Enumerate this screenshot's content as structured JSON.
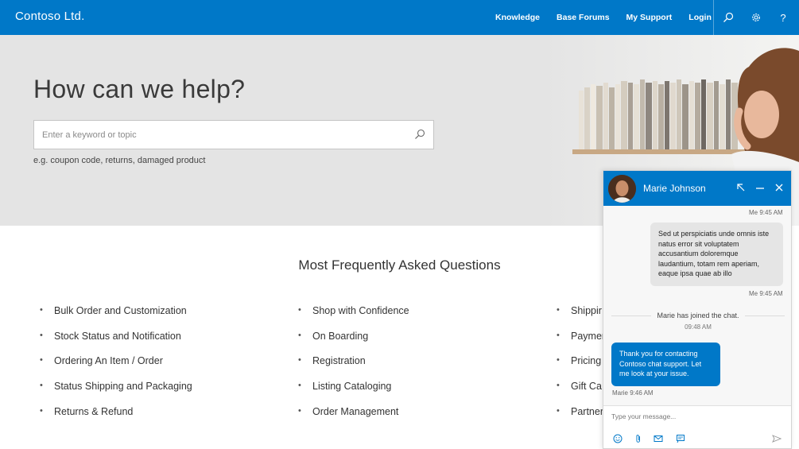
{
  "header": {
    "brand": "Contoso Ltd.",
    "nav": [
      "Knowledge",
      "Base Forums",
      "My Support",
      "Login"
    ],
    "icons": [
      "search-icon",
      "gear-icon",
      "help-icon"
    ],
    "color": "#0078c8"
  },
  "hero": {
    "title": "How can we help?",
    "search_placeholder": "Enter a keyword or topic",
    "hint": "e.g. coupon code, returns, damaged product"
  },
  "faq": {
    "title": "Most Frequently Asked Questions",
    "columns": [
      [
        "Bulk Order and Customization",
        "Stock Status and Notification",
        "Ordering An Item / Order",
        "Status Shipping and Packaging",
        "Returns & Refund"
      ],
      [
        "Shop with Confidence",
        "On Boarding",
        "Registration",
        "Listing Cataloging",
        "Order Management"
      ],
      [
        "Shippir",
        "Paymer",
        "Pricing",
        "Gift Ca",
        "Partner"
      ]
    ]
  },
  "chat": {
    "agent_name": "Marie Johnson",
    "top_meta": "Me 9:45 AM",
    "my_message": "Sed ut perspiciatis unde omnis iste natus error sit voluptatem accusantium doloremque laudantium, totam rem aperiam, eaque ipsa quae ab illo",
    "my_meta": "Me 9:45 AM",
    "system_text": "Marie has joined the chat.",
    "system_time": "09:48 AM",
    "agent_message": "Thank you for contacting Contoso chat support. Let me look at your issue.",
    "agent_meta": "Marie 9:46 AM",
    "input_placeholder": "Type your message...",
    "tools": [
      "emoji-icon",
      "attach-icon",
      "email-icon",
      "transcript-icon",
      "send-icon"
    ]
  }
}
